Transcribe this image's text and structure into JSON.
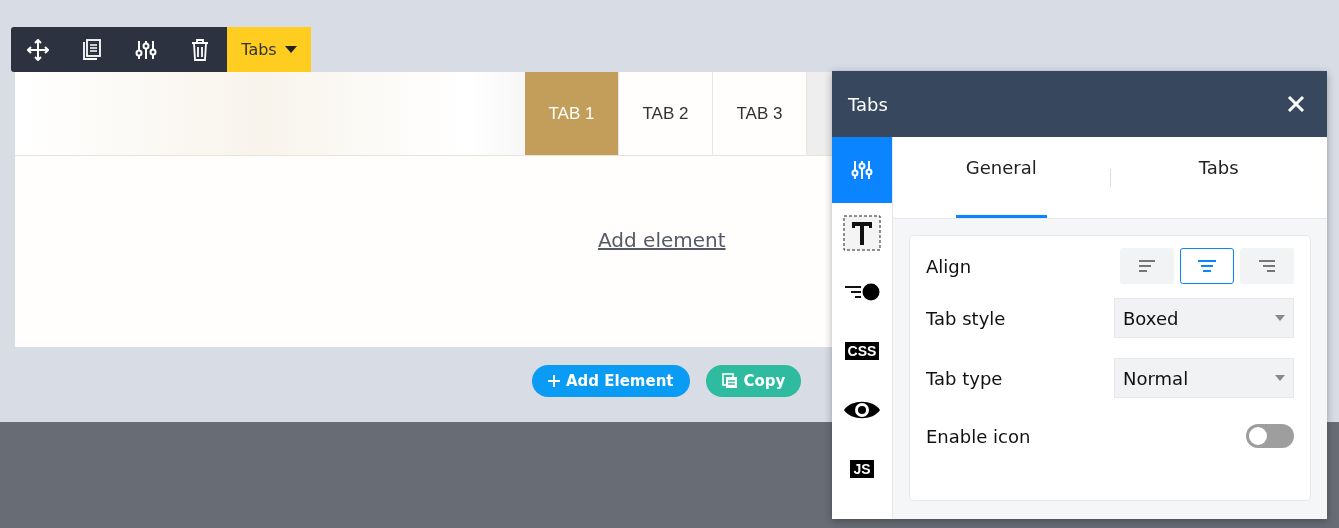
{
  "toolbar": {
    "element_label": "Tabs"
  },
  "tabs": [
    {
      "label": "TAB 1",
      "selected": true
    },
    {
      "label": "TAB 2",
      "selected": false
    },
    {
      "label": "TAB 3",
      "selected": false
    }
  ],
  "content_link": "Add element",
  "actions": [
    {
      "kind": "add",
      "label": "Add Element"
    },
    {
      "kind": "copy",
      "label": "Copy"
    }
  ],
  "panel": {
    "title": "Tabs",
    "rail": [
      {
        "kind": "settings",
        "selected": true
      },
      {
        "kind": "text",
        "selected": false
      },
      {
        "kind": "animation",
        "selected": false
      },
      {
        "kind": "css",
        "label": "CSS",
        "selected": false
      },
      {
        "kind": "eye",
        "selected": false
      },
      {
        "kind": "js",
        "label": "JS",
        "selected": false
      }
    ],
    "tabs": [
      {
        "label": "General",
        "selected": true
      },
      {
        "label": "Tabs",
        "selected": false
      }
    ],
    "align": {
      "label": "Align",
      "options": [
        {
          "kind": "left",
          "selected": false
        },
        {
          "kind": "center",
          "selected": true
        },
        {
          "kind": "right",
          "selected": false
        }
      ]
    },
    "tab_style": {
      "label": "Tab style",
      "value": "Boxed"
    },
    "tab_type": {
      "label": "Tab type",
      "value": "Normal"
    },
    "enable_icon": {
      "label": "Enable icon",
      "on": false
    }
  }
}
